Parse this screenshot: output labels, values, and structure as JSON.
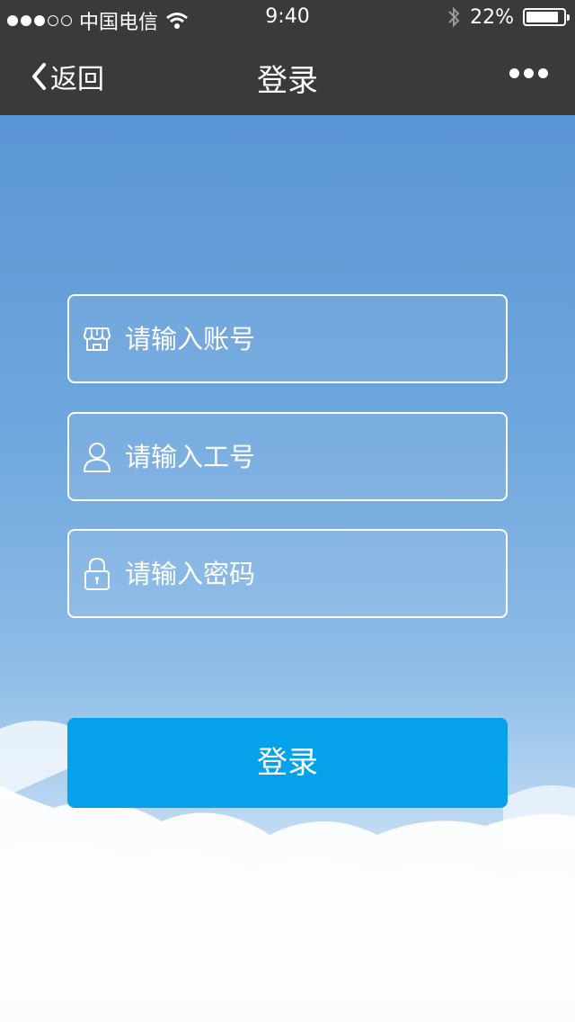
{
  "status_bar": {
    "carrier": "中国电信",
    "time": "9:40",
    "battery_text": "22%",
    "battery_level": 0.22,
    "signal_strength": 3,
    "signal_max": 5
  },
  "nav": {
    "back_label": "返回",
    "title": "登录"
  },
  "form": {
    "account_placeholder": "请输入账号",
    "employee_id_placeholder": "请输入工号",
    "password_placeholder": "请输入密码",
    "submit_label": "登录"
  },
  "colors": {
    "nav_background": "#3a3a3a",
    "sky_top": "#5a95d5",
    "button_background": "#05a1ea",
    "field_border": "#ffffff"
  },
  "icons": {
    "account": "store-icon",
    "employee_id": "user-icon",
    "password": "lock-icon"
  }
}
